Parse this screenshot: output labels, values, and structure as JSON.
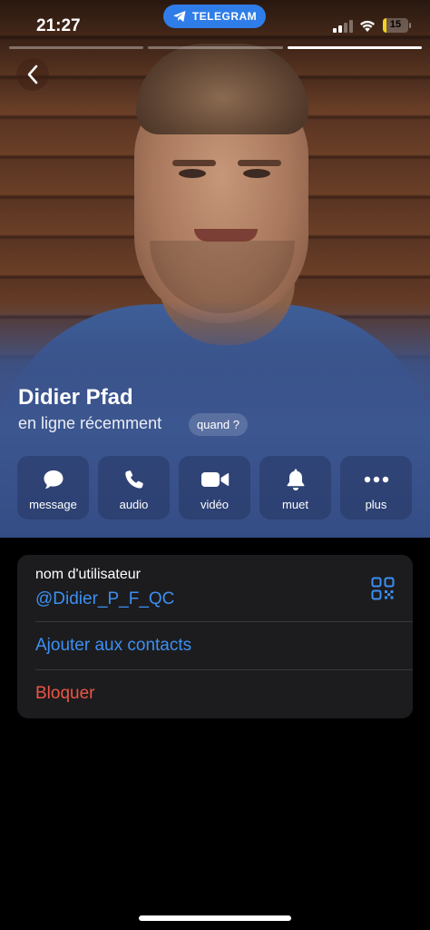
{
  "status_bar": {
    "time": "21:27",
    "app_pill": "TELEGRAM",
    "battery": "15",
    "battery_level": 0.15,
    "icons": [
      "telegram-icon",
      "signal-icon",
      "wifi-icon",
      "battery-icon"
    ]
  },
  "story": {
    "bars": 3,
    "active_index": 2
  },
  "profile": {
    "name": "Didier Pfad",
    "presence": "en ligne récemment",
    "presence_button": "quand ?"
  },
  "actions": [
    {
      "label": "message",
      "icon": "chat-bubble-icon"
    },
    {
      "label": "audio",
      "icon": "phone-icon"
    },
    {
      "label": "vidéo",
      "icon": "video-camera-icon"
    },
    {
      "label": "muet",
      "icon": "bell-icon"
    },
    {
      "label": "plus",
      "icon": "more-dots-icon"
    }
  ],
  "info": {
    "username_label": "nom d'utilisateur",
    "username_value": "@Didier_P_F_QC",
    "add_contact": "Ajouter aux contacts",
    "block": "Bloquer"
  },
  "colors": {
    "link": "#3d8ff2",
    "danger": "#eb5545",
    "telegram_pill": "#2f7de8",
    "battery": "#f2d21c",
    "card": "#1c1c1e"
  }
}
